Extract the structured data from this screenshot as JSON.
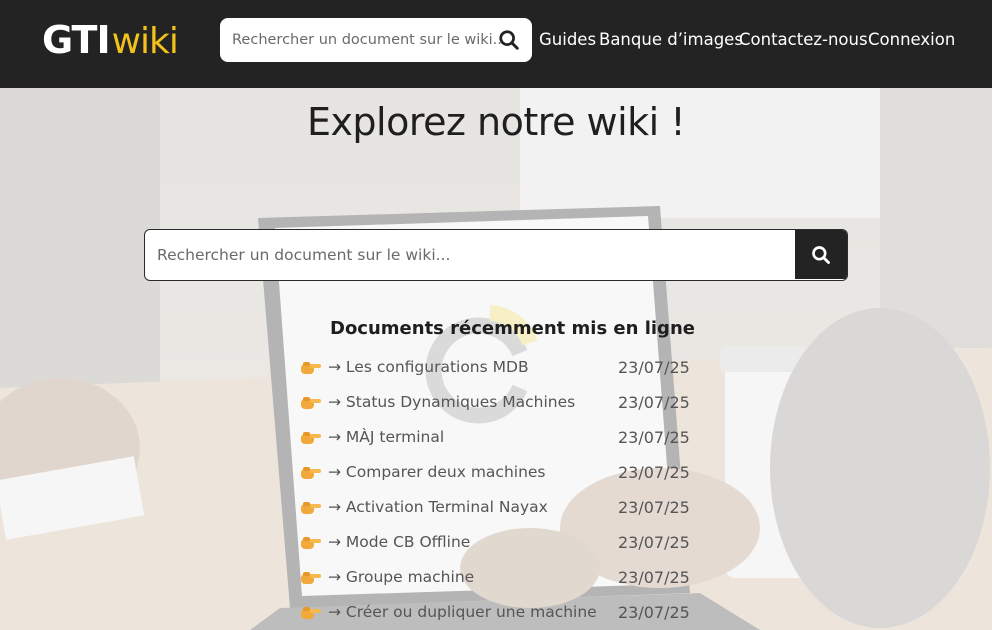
{
  "header": {
    "logo": {
      "part1": "GTI",
      "part2": "wiki"
    },
    "search": {
      "placeholder": "Rechercher un document sur le wiki..."
    },
    "nav": {
      "guides": "Guides",
      "images": "Banque d’images",
      "contact": "Contactez-nous",
      "login": "Connexion"
    }
  },
  "main": {
    "title": "Explorez notre wiki !",
    "search": {
      "placeholder": "Rechercher un document sur le wiki..."
    },
    "recent": {
      "heading": "Documents récemment mis en ligne",
      "items": [
        {
          "name": "→ Les configurations MDB",
          "date": "23/07/25"
        },
        {
          "name": "→ Status Dynamiques Machines",
          "date": "23/07/25"
        },
        {
          "name": "→ MÀJ terminal",
          "date": "23/07/25"
        },
        {
          "name": "→ Comparer deux machines",
          "date": "23/07/25"
        },
        {
          "name": "→ Activation Terminal Nayax",
          "date": "23/07/25"
        },
        {
          "name": "→ Mode CB Offline",
          "date": "23/07/25"
        },
        {
          "name": "→ Groupe machine",
          "date": "23/07/25"
        },
        {
          "name": "→ Créer ou dupliquer une machine",
          "date": "23/07/25"
        }
      ]
    }
  },
  "icons": {
    "search": "search-icon",
    "bullet": "pointing-hand-icon"
  },
  "colors": {
    "header": "#232323",
    "accent": "#f2c21b",
    "text": "#1f1f1f"
  }
}
